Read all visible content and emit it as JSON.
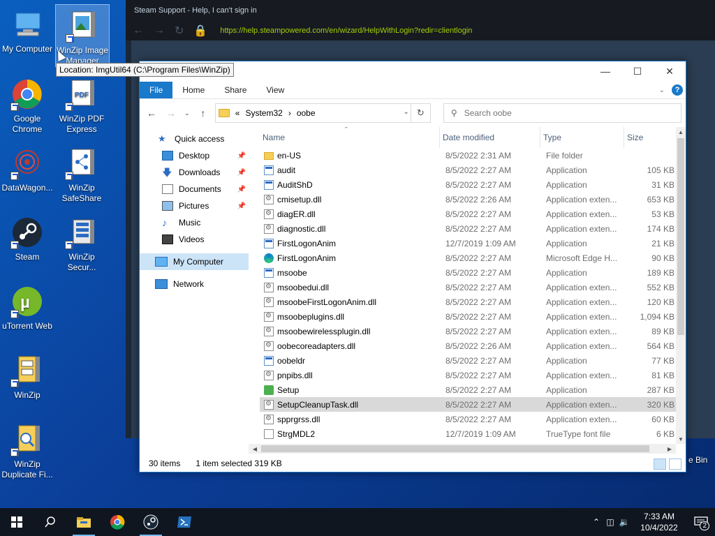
{
  "desktop_icons": [
    {
      "label": "My Computer"
    },
    {
      "label": "WinZip Image Manager"
    },
    {
      "label": "Google Chrome"
    },
    {
      "label": "WinZip PDF Express"
    },
    {
      "label": "DataWagon..."
    },
    {
      "label": "WinZip SafeShare"
    },
    {
      "label": "Steam"
    },
    {
      "label": "WinZip Secur..."
    },
    {
      "label": "uTorrent Web"
    },
    {
      "label": "WinZip"
    },
    {
      "label": "WinZip Duplicate Fi..."
    }
  ],
  "tooltip": "Location: ImgUtil64 (C:\\Program Files\\WinZip)",
  "steam": {
    "title": "Steam Support - Help, I can't sign in",
    "url": "https://help.steampowered.com/en/wizard/HelpWithLogin?redir=clientlogin"
  },
  "recycle_bin_label": "e Bin",
  "explorer": {
    "ribbon_tabs": [
      "File",
      "Home",
      "Share",
      "View"
    ],
    "breadcrumb": {
      "prefix": "«",
      "part1": "System32",
      "sep": "›",
      "part2": "oobe"
    },
    "search_placeholder": "Search oobe",
    "nav": {
      "quick_access": "Quick access",
      "desktop": "Desktop",
      "downloads": "Downloads",
      "documents": "Documents",
      "pictures": "Pictures",
      "music": "Music",
      "videos": "Videos",
      "my_computer": "My Computer",
      "network": "Network"
    },
    "columns": {
      "name": "Name",
      "date": "Date modified",
      "type": "Type",
      "size": "Size"
    },
    "files": [
      {
        "name": "en-US",
        "date": "8/5/2022 2:31 AM",
        "type": "File folder",
        "size": "",
        "icon": "folder"
      },
      {
        "name": "audit",
        "date": "8/5/2022 2:27 AM",
        "type": "Application",
        "size": "105 KB",
        "icon": "app"
      },
      {
        "name": "AuditShD",
        "date": "8/5/2022 2:27 AM",
        "type": "Application",
        "size": "31 KB",
        "icon": "app"
      },
      {
        "name": "cmisetup.dll",
        "date": "8/5/2022 2:26 AM",
        "type": "Application exten...",
        "size": "653 KB",
        "icon": "dll"
      },
      {
        "name": "diagER.dll",
        "date": "8/5/2022 2:27 AM",
        "type": "Application exten...",
        "size": "53 KB",
        "icon": "dll"
      },
      {
        "name": "diagnostic.dll",
        "date": "8/5/2022 2:27 AM",
        "type": "Application exten...",
        "size": "174 KB",
        "icon": "dll"
      },
      {
        "name": "FirstLogonAnim",
        "date": "12/7/2019 1:09 AM",
        "type": "Application",
        "size": "21 KB",
        "icon": "app"
      },
      {
        "name": "FirstLogonAnim",
        "date": "8/5/2022 2:27 AM",
        "type": "Microsoft Edge H...",
        "size": "90 KB",
        "icon": "edge"
      },
      {
        "name": "msoobe",
        "date": "8/5/2022 2:27 AM",
        "type": "Application",
        "size": "189 KB",
        "icon": "app"
      },
      {
        "name": "msoobedui.dll",
        "date": "8/5/2022 2:27 AM",
        "type": "Application exten...",
        "size": "552 KB",
        "icon": "dll"
      },
      {
        "name": "msoobeFirstLogonAnim.dll",
        "date": "8/5/2022 2:27 AM",
        "type": "Application exten...",
        "size": "120 KB",
        "icon": "dll"
      },
      {
        "name": "msoobeplugins.dll",
        "date": "8/5/2022 2:27 AM",
        "type": "Application exten...",
        "size": "1,094 KB",
        "icon": "dll"
      },
      {
        "name": "msoobewirelessplugin.dll",
        "date": "8/5/2022 2:27 AM",
        "type": "Application exten...",
        "size": "89 KB",
        "icon": "dll"
      },
      {
        "name": "oobecoreadapters.dll",
        "date": "8/5/2022 2:26 AM",
        "type": "Application exten...",
        "size": "564 KB",
        "icon": "dll"
      },
      {
        "name": "oobeldr",
        "date": "8/5/2022 2:27 AM",
        "type": "Application",
        "size": "77 KB",
        "icon": "app"
      },
      {
        "name": "pnpibs.dll",
        "date": "8/5/2022 2:27 AM",
        "type": "Application exten...",
        "size": "81 KB",
        "icon": "dll"
      },
      {
        "name": "Setup",
        "date": "8/5/2022 2:27 AM",
        "type": "Application",
        "size": "287 KB",
        "icon": "setup"
      },
      {
        "name": "SetupCleanupTask.dll",
        "date": "8/5/2022 2:27 AM",
        "type": "Application exten...",
        "size": "320 KB",
        "icon": "dll",
        "selected": true
      },
      {
        "name": "spprgrss.dll",
        "date": "8/5/2022 2:27 AM",
        "type": "Application exten...",
        "size": "60 KB",
        "icon": "dll"
      },
      {
        "name": "StrgMDL2",
        "date": "12/7/2019 1:09 AM",
        "type": "TrueType font file",
        "size": "6 KB",
        "icon": "font"
      }
    ],
    "status": {
      "count": "30 items",
      "selected": "1 item selected",
      "size": "319 KB"
    }
  },
  "taskbar": {
    "time": "7:33 AM",
    "date": "10/4/2022",
    "notification_count": "2"
  },
  "colors": {
    "accent": "#1979ca",
    "taskbar": "#0f1620",
    "steam_url": "#a4d007"
  }
}
